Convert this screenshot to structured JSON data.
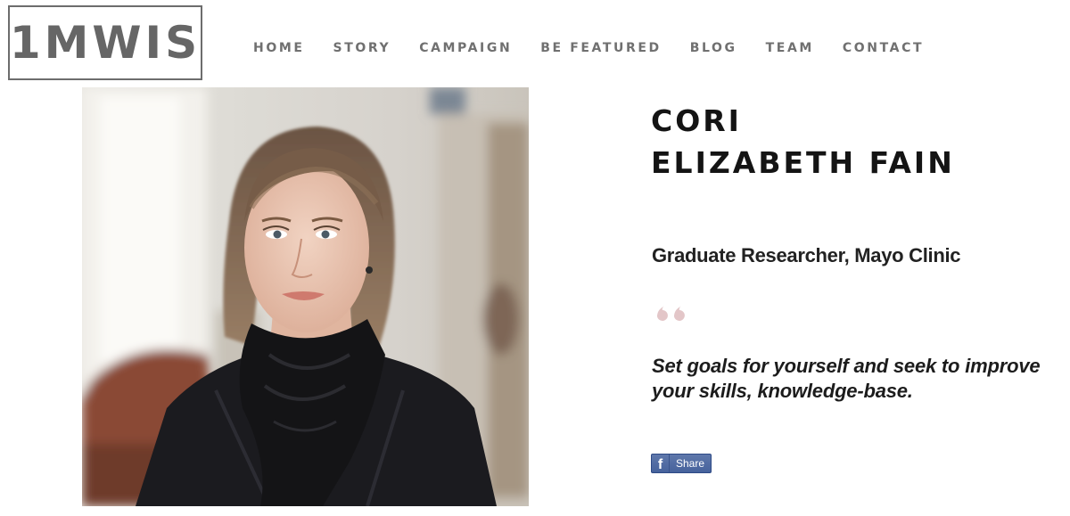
{
  "logo": {
    "text": "1MWIS"
  },
  "nav": {
    "items": [
      {
        "label": "HOME"
      },
      {
        "label": "STORY"
      },
      {
        "label": "CAMPAIGN"
      },
      {
        "label": "BE FEATURED"
      },
      {
        "label": "BLOG"
      },
      {
        "label": "TEAM"
      },
      {
        "label": "CONTACT"
      }
    ]
  },
  "profile": {
    "name_line1": "CORI",
    "name_line2": "ELIZABETH FAIN",
    "role": "Graduate Researcher, Mayo Clinic",
    "quote": "Set goals for yourself and seek to improve your skills, knowledge-base.",
    "quote_mark_color": "#e3c6c8"
  },
  "share": {
    "icon": "facebook-icon",
    "icon_glyph": "f",
    "label": "Share",
    "color": "#4b67a1"
  },
  "photo": {
    "subject": "portrait-photo"
  }
}
